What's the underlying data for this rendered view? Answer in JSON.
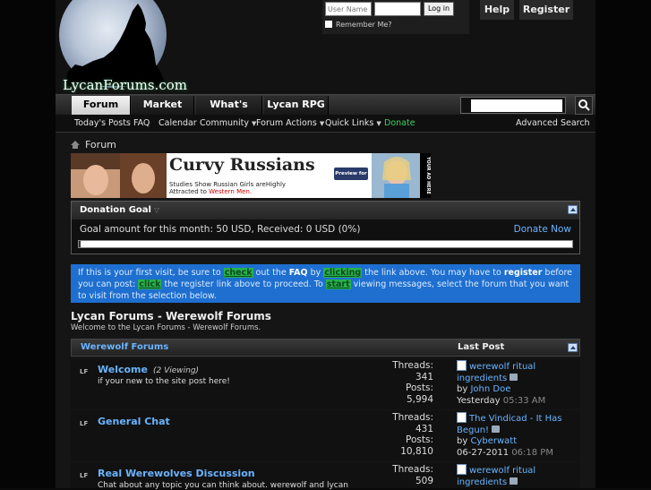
{
  "header": {
    "logo_text": "LycanForums.com",
    "login": {
      "username_placeholder": "User Name",
      "password_placeholder": "",
      "login_button": "Log in",
      "remember_me": "Remember Me?"
    },
    "help": "Help",
    "register": "Register"
  },
  "nav": {
    "tabs": [
      {
        "label": "Forum",
        "active": true
      },
      {
        "label": "Market",
        "active": false
      },
      {
        "label": "What's New?",
        "active": false
      },
      {
        "label": "Lycan RPG",
        "active": false
      }
    ],
    "search_placeholder": ""
  },
  "subnav": {
    "todays_posts": "Today's Posts",
    "faq": "FAQ",
    "calendar": "Calendar",
    "community": "Community",
    "forum_actions": "Forum Actions",
    "quick_links": "Quick Links",
    "donate": "Donate",
    "advanced_search": "Advanced Search"
  },
  "breadcrumb": {
    "label": "Forum"
  },
  "ad": {
    "headline": "Curvy Russians",
    "subline_a": "Studies Show Russian Girls areHighly Attracted to",
    "subline_b": "Western Men.",
    "preview": "Preview for FREE",
    "side": "YOUR AD HERE"
  },
  "donation": {
    "title": "Donation Goal",
    "text": "Goal amount for this month: 50 USD, Received: 0 USD (0%)",
    "donate_now": "Donate Now",
    "progress_fraction": 0.0
  },
  "notice": {
    "t1": "If this is your first visit, be sure to",
    "l1": "check",
    "t2": "out the",
    "faq": "FAQ",
    "t3": "by",
    "l2": "clicking",
    "t4": "the link above. You may have to",
    "register": "register",
    "t5": "before you can post:",
    "l3": "click",
    "t6": "the register link above to proceed. To",
    "l4": "start",
    "t7": "viewing messages, select the forum that you want to visit from the selection below."
  },
  "forums": {
    "title": "Lycan Forums - Werewolf Forums",
    "subtitle": "Welcome to the Lycan Forums - Werewolf Forums.",
    "section": "Werewolf Forums",
    "last_post_header": "Last Post",
    "rows": [
      {
        "icon": "LF",
        "name": "Welcome",
        "viewing": "(2 Viewing)",
        "desc": "if your new to the site post here!",
        "threads_label": "Threads:",
        "threads": "341",
        "posts_label": "Posts:",
        "posts": "5,994",
        "lp_title": "werewolf ritual ingredients",
        "lp_by": "by",
        "lp_user": "John Doe",
        "lp_date": "Yesterday",
        "lp_time": "05:33 AM"
      },
      {
        "icon": "LF",
        "name": "General Chat",
        "viewing": "",
        "desc": "",
        "threads_label": "Threads:",
        "threads": "431",
        "posts_label": "Posts:",
        "posts": "10,810",
        "lp_title": "The Vindicad - It Has Begun!",
        "lp_by": "by",
        "lp_user": "Cyberwatt",
        "lp_date": "06-27-2011",
        "lp_time": "06:18 PM"
      },
      {
        "icon": "LF",
        "name": "Real Werewolves Discussion",
        "viewing": "",
        "desc": "Chat about any topic you can think about. werewolf and lycan",
        "threads_label": "Threads:",
        "threads": "509",
        "posts_label": "",
        "posts": "",
        "lp_title": "werewolf ritual ingredients",
        "lp_by": "",
        "lp_user": "",
        "lp_date": "",
        "lp_time": ""
      }
    ]
  }
}
